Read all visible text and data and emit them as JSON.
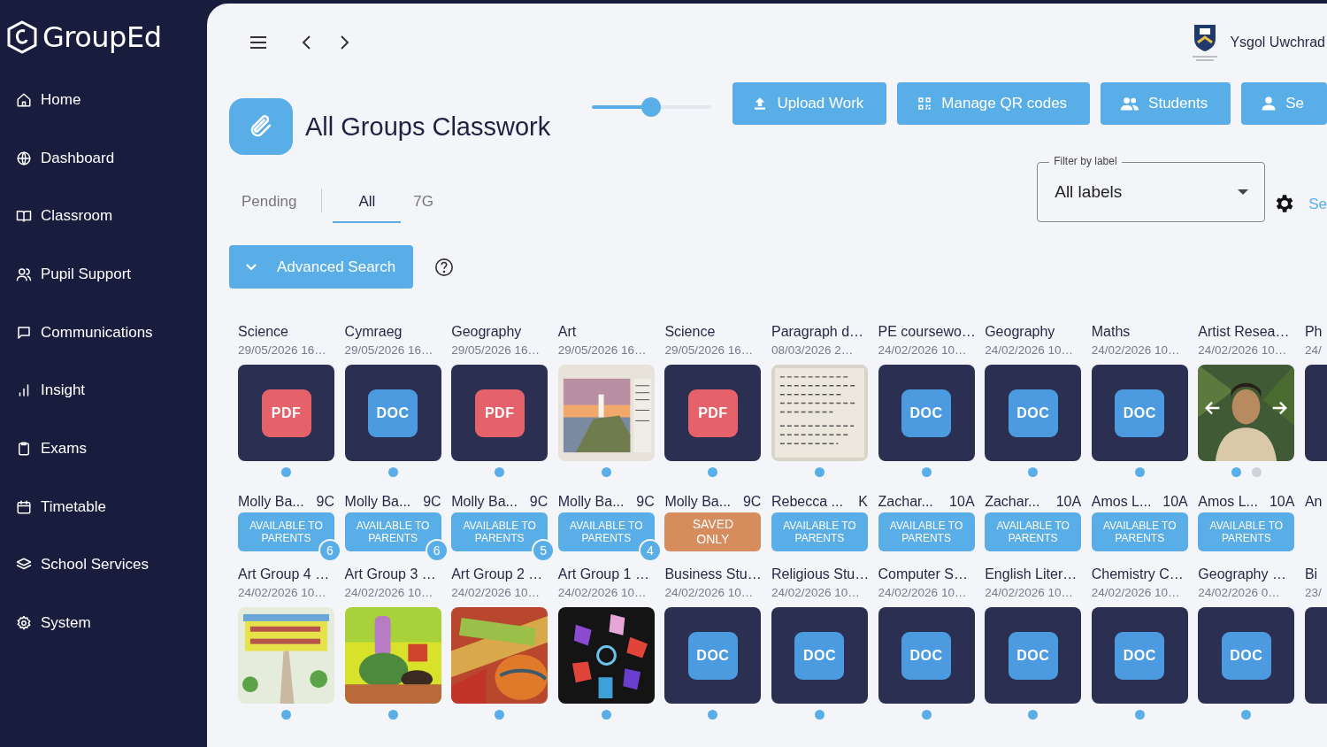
{
  "app": {
    "name": "GroupEd"
  },
  "sidebar": {
    "items": [
      {
        "label": "Home"
      },
      {
        "label": "Dashboard"
      },
      {
        "label": "Classroom"
      },
      {
        "label": "Pupil Support"
      },
      {
        "label": "Communications"
      },
      {
        "label": "Insight"
      },
      {
        "label": "Exams"
      },
      {
        "label": "Timetable"
      },
      {
        "label": "School Services"
      },
      {
        "label": "System"
      }
    ]
  },
  "header": {
    "school": "Ysgol Uwchrad"
  },
  "page": {
    "title": "All Groups Classwork",
    "zoom": {
      "level": 0.5
    },
    "actions": [
      {
        "label": "Upload Work"
      },
      {
        "label": "Manage QR codes"
      },
      {
        "label": "Students"
      },
      {
        "label": "Se"
      }
    ],
    "tabs": [
      {
        "label": "Pending",
        "selected": false
      },
      {
        "label": "All",
        "selected": true
      },
      {
        "label": "7G",
        "selected": false
      }
    ],
    "filter": {
      "label": "Filter by label",
      "value": "All labels"
    },
    "settings_link": "Se",
    "advanced_search": "Advanced Search"
  },
  "rows": [
    {
      "cards": [
        {
          "title": "Science",
          "date": "29/05/2026 16…",
          "kind": "pdf",
          "thumb_label": "PDF",
          "pages": [
            {
              "selected": true
            }
          ],
          "student": "Molly Ba...",
          "group": "9C",
          "status": {
            "text": "AVAILABLE TO PARENTS",
            "kind": "available"
          },
          "count": "6"
        },
        {
          "title": "Cymraeg",
          "date": "29/05/2026 16…",
          "kind": "doc",
          "thumb_label": "DOC",
          "pages": [
            {
              "selected": true
            }
          ],
          "student": "Molly Ba...",
          "group": "9C",
          "status": {
            "text": "AVAILABLE TO PARENTS",
            "kind": "available"
          },
          "count": "6"
        },
        {
          "title": "Geography",
          "date": "29/05/2026 16…",
          "kind": "pdf",
          "thumb_label": "PDF",
          "pages": [
            {
              "selected": true
            }
          ],
          "student": "Molly Ba...",
          "group": "9C",
          "status": {
            "text": "AVAILABLE TO PARENTS",
            "kind": "available"
          },
          "count": "5"
        },
        {
          "title": "Art",
          "date": "29/05/2026 16…",
          "kind": "picture",
          "pages": [
            {
              "selected": true
            }
          ],
          "student": "Molly Ba...",
          "group": "9C",
          "status": {
            "text": "AVAILABLE TO PARENTS",
            "kind": "available"
          },
          "count": "4"
        },
        {
          "title": "Science",
          "date": "29/05/2026 16…",
          "kind": "pdf",
          "thumb_label": "PDF",
          "pages": [
            {
              "selected": true
            }
          ],
          "student": "Molly Ba...",
          "group": "9C",
          "status": {
            "text": "SAVED ONLY",
            "kind": "saved"
          }
        },
        {
          "title": "Paragraph d…",
          "date": "08/03/2026 2…",
          "kind": "picture",
          "pages": [
            {
              "selected": true
            }
          ],
          "student": "Rebecca ...",
          "group": "K",
          "status": {
            "text": "AVAILABLE TO PARENTS",
            "kind": "available"
          }
        },
        {
          "title": "PE coursewo…",
          "date": "24/02/2026 10…",
          "kind": "doc",
          "thumb_label": "DOC",
          "pages": [
            {
              "selected": true
            }
          ],
          "student": "Zachar...",
          "group": "10A",
          "status": {
            "text": "AVAILABLE TO PARENTS",
            "kind": "available"
          }
        },
        {
          "title": "Geography",
          "date": "24/02/2026 10…",
          "kind": "doc",
          "thumb_label": "DOC",
          "pages": [
            {
              "selected": true
            }
          ],
          "student": "Zachar...",
          "group": "10A",
          "status": {
            "text": "AVAILABLE TO PARENTS",
            "kind": "available"
          }
        },
        {
          "title": "Maths",
          "date": "24/02/2026 10…",
          "kind": "doc",
          "thumb_label": "DOC",
          "pages": [
            {
              "selected": true
            }
          ],
          "student": "Amos L...",
          "group": "10A",
          "status": {
            "text": "AVAILABLE TO PARENTS",
            "kind": "available"
          }
        },
        {
          "title": "Artist Resea…",
          "date": "24/02/2026 10…",
          "kind": "picture",
          "pages": [
            {
              "selected": true
            },
            {
              "selected": false
            }
          ],
          "student": "Amos L...",
          "group": "10A",
          "status": {
            "text": "AVAILABLE TO PARENTS",
            "kind": "available"
          }
        },
        {
          "title": "Ph",
          "date": "24/",
          "kind": "tile",
          "student": "An"
        }
      ]
    },
    {
      "cards": [
        {
          "title": "Art Group 4 …",
          "date": "24/02/2026 10…",
          "kind": "picture",
          "pages": [
            {
              "selected": true
            }
          ]
        },
        {
          "title": "Art Group 3 …",
          "date": "24/02/2026 10…",
          "kind": "picture",
          "pages": [
            {
              "selected": true
            }
          ]
        },
        {
          "title": "Art Group 2 …",
          "date": "24/02/2026 10…",
          "kind": "picture",
          "pages": [
            {
              "selected": true
            }
          ]
        },
        {
          "title": "Art Group 1 …",
          "date": "24/02/2026 10…",
          "kind": "picture",
          "pages": [
            {
              "selected": true
            }
          ]
        },
        {
          "title": "Business Stu…",
          "date": "24/02/2026 10…",
          "kind": "doc",
          "thumb_label": "DOC",
          "pages": [
            {
              "selected": true
            }
          ]
        },
        {
          "title": "Religious Stu…",
          "date": "24/02/2026 10…",
          "kind": "doc",
          "thumb_label": "DOC",
          "pages": [
            {
              "selected": true
            }
          ]
        },
        {
          "title": "Computer S…",
          "date": "24/02/2026 10…",
          "kind": "doc",
          "thumb_label": "DOC",
          "pages": [
            {
              "selected": true
            }
          ]
        },
        {
          "title": "English Liter…",
          "date": "24/02/2026 10…",
          "kind": "doc",
          "thumb_label": "DOC",
          "pages": [
            {
              "selected": true
            }
          ]
        },
        {
          "title": "Chemistry C…",
          "date": "24/02/2026 10…",
          "kind": "doc",
          "thumb_label": "DOC",
          "pages": [
            {
              "selected": true
            }
          ]
        },
        {
          "title": "Geography …",
          "date": "24/02/2026 0…",
          "kind": "doc",
          "thumb_label": "DOC",
          "pages": [
            {
              "selected": true
            }
          ]
        },
        {
          "title": "Bi",
          "date": "23/",
          "kind": "tile"
        }
      ]
    }
  ]
}
